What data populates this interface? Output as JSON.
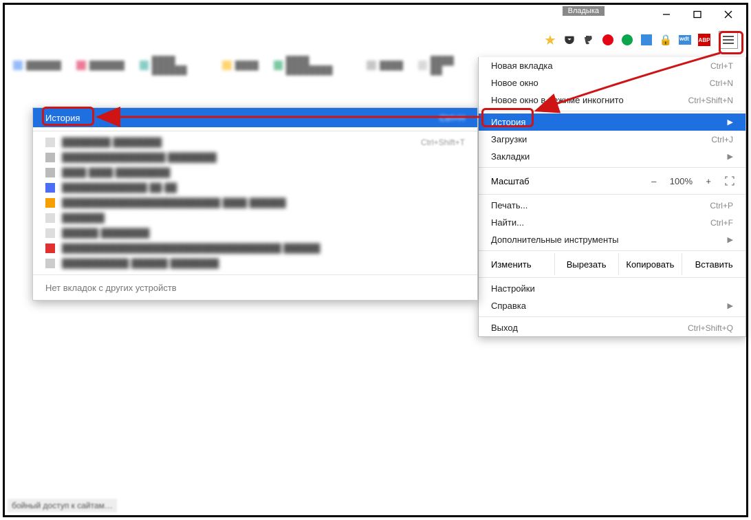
{
  "user_tag": "Владыка",
  "menu": {
    "new_tab": {
      "label": "Новая вкладка",
      "sc": "Ctrl+T"
    },
    "new_window": {
      "label": "Новое окно",
      "sc": "Ctrl+N"
    },
    "incognito": {
      "label": "Новое окно в режиме инкогнито",
      "sc": "Ctrl+Shift+N"
    },
    "history": {
      "label": "История"
    },
    "downloads": {
      "label": "Загрузки",
      "sc": "Ctrl+J"
    },
    "bookmarks": {
      "label": "Закладки"
    },
    "zoom_label": "Масштаб",
    "zoom_minus": "–",
    "zoom_value": "100%",
    "zoom_plus": "+",
    "print": {
      "label": "Печать...",
      "sc": "Ctrl+P"
    },
    "find": {
      "label": "Найти...",
      "sc": "Ctrl+F"
    },
    "more_tools": {
      "label": "Дополнительные инструменты"
    },
    "edit_label": "Изменить",
    "cut": "Вырезать",
    "copy": "Копировать",
    "paste": "Вставить",
    "settings": {
      "label": "Настройки"
    },
    "help": {
      "label": "Справка"
    },
    "exit": {
      "label": "Выход",
      "sc": "Ctrl+Shift+Q"
    }
  },
  "history_panel": {
    "title": "История",
    "shortcut": "Ctrl+H",
    "recent_shortcut": "Ctrl+Shift+T",
    "no_tabs": "Нет вкладок с других устройств"
  },
  "bottom_tip": "бойный доступ к сайтам…",
  "abp_text": "ABP"
}
